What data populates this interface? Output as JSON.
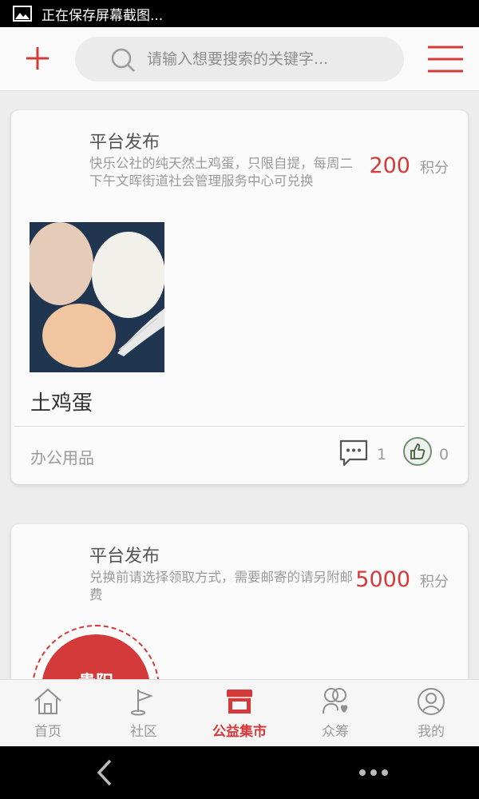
{
  "status_bar": {
    "text": "正在保存屏幕截图..."
  },
  "header": {
    "search_placeholder": "请输入想要搜索的关键字..."
  },
  "colors": {
    "accent": "#d43a3a",
    "muted": "#9a9a9a"
  },
  "cards": [
    {
      "publisher": "平台发布",
      "description": "快乐公社的纯天然土鸡蛋，只限自提，每周二下午文晖街道社会管理服务中心可兑换",
      "points": "200",
      "points_unit": "积分",
      "title": "土鸡蛋",
      "category": "办公用品",
      "comments": "1",
      "likes": "0"
    },
    {
      "publisher": "平台发布",
      "description": "兑换前请选择领取方式，需要邮寄的请另附邮费",
      "points": "5000",
      "points_unit": "积分",
      "stamp_text": "贵阳"
    }
  ],
  "bottom_nav": [
    {
      "label": "首页",
      "icon": "home-icon"
    },
    {
      "label": "社区",
      "icon": "flag-icon"
    },
    {
      "label": "公益集市",
      "icon": "store-icon",
      "active": true
    },
    {
      "label": "众筹",
      "icon": "crowdfund-icon"
    },
    {
      "label": "我的",
      "icon": "user-icon"
    }
  ]
}
